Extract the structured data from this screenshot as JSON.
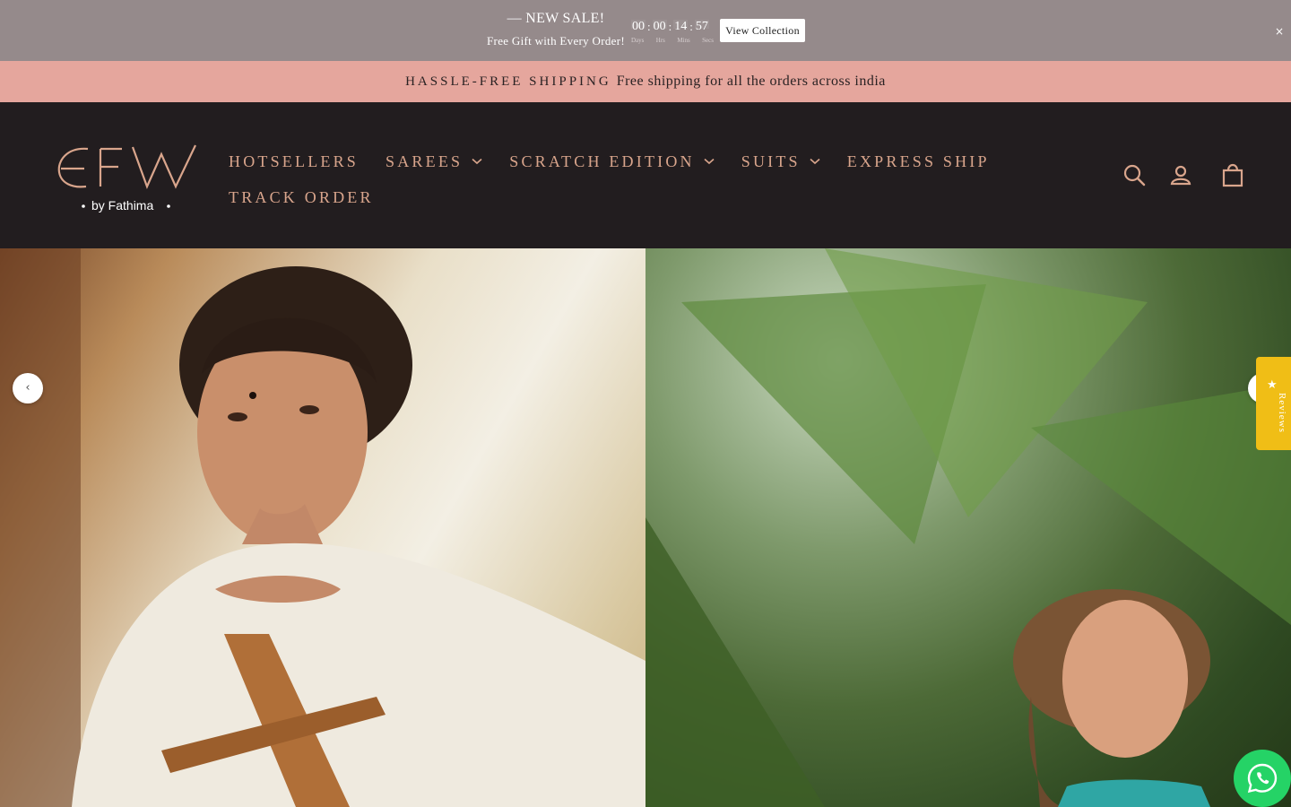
{
  "promo": {
    "headline": "— NEW SALE!",
    "subtext": "Free Gift with Every Order!",
    "countdown": {
      "days": "00",
      "hours": "00",
      "minutes": "14",
      "seconds": "57",
      "labels": {
        "days": "Days",
        "hours": "Hrs",
        "minutes": "Mins",
        "seconds": "Secs"
      }
    },
    "cta_label": "View Collection",
    "close_icon": "×"
  },
  "announcement": {
    "strong": "HASSLE-FREE SHIPPING",
    "text": "Free shipping for all the orders across india"
  },
  "header": {
    "logo": {
      "mark": "EFW",
      "tagline": "• by Fathima •"
    },
    "nav": [
      {
        "label": "HOTSELLERS",
        "has_dropdown": false
      },
      {
        "label": "SAREES",
        "has_dropdown": true
      },
      {
        "label": "SCRATCH EDITION",
        "has_dropdown": true
      },
      {
        "label": "SUITS",
        "has_dropdown": true
      },
      {
        "label": "EXPRESS SHIP",
        "has_dropdown": false
      },
      {
        "label": "TRACK ORDER",
        "has_dropdown": false
      }
    ],
    "icons": [
      "search-icon",
      "account-icon",
      "cart-icon"
    ]
  },
  "hero": {
    "prev_arrow": "‹",
    "next_arrow": "›"
  },
  "reviews_tab": {
    "star": "★",
    "label": "Reviews"
  },
  "colors": {
    "promo_bg": "#958a8b",
    "announcement_bg": "#e5a69d",
    "header_bg": "#221d1f",
    "nav_text": "#d9a58c",
    "reviews_tab": "#f0be16",
    "whatsapp": "#25d366"
  }
}
